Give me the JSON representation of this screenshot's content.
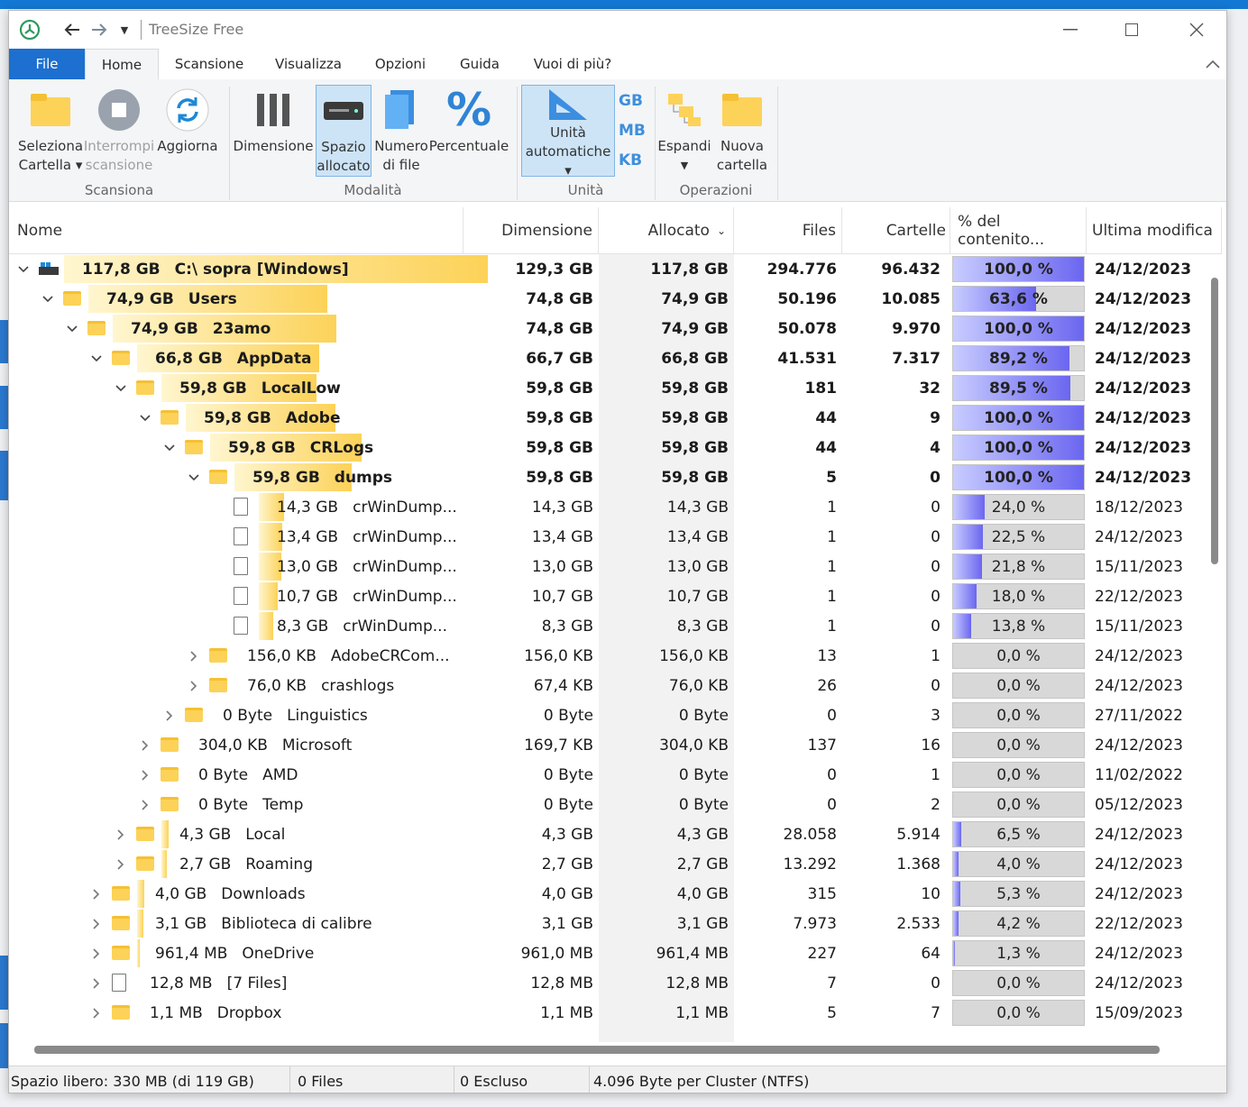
{
  "window": {
    "title": "TreeSize Free"
  },
  "tabs": [
    "File",
    "Home",
    "Scansione",
    "Visualizza",
    "Opzioni",
    "Guida",
    "Vuoi di più?"
  ],
  "ribbon": {
    "select_folder": [
      "Seleziona",
      "Cartella"
    ],
    "stop_scan": [
      "Interrompi",
      "scansione"
    ],
    "refresh": [
      "Aggiorna"
    ],
    "size": [
      "Dimensione"
    ],
    "allocated": [
      "Spazio",
      "allocato"
    ],
    "file_count": [
      "Numero",
      "di file"
    ],
    "percent": [
      "Percentuale"
    ],
    "auto_units": [
      "Unità",
      "automatiche"
    ],
    "units": [
      "GB",
      "MB",
      "KB"
    ],
    "expand": [
      "Espandi"
    ],
    "new_folder": [
      "Nuova",
      "cartella"
    ],
    "groups": [
      "Scansiona",
      "Modalità",
      "Unità",
      "Operazioni"
    ]
  },
  "columns": [
    "Nome",
    "Dimensione",
    "Allocato",
    "Files",
    "Cartelle",
    "% del contenito...",
    "Ultima modifica"
  ],
  "rows": [
    {
      "size_label": "117,8 GB",
      "name": "C:\\  sopra  [Windows]",
      "size": "129,3 GB",
      "alloc": "117,8 GB",
      "files": "294.776",
      "folders": "96.432",
      "pct": "100,0 %",
      "pct_value": 100,
      "date": "24/12/2023"
    },
    {
      "size_label": "74,9 GB",
      "name": "Users",
      "size": "74,8 GB",
      "alloc": "74,9 GB",
      "files": "50.196",
      "folders": "10.085",
      "pct": "63,6 %",
      "pct_value": 63.6,
      "date": "24/12/2023"
    },
    {
      "size_label": "74,9 GB",
      "name": "23amo",
      "size": "74,8 GB",
      "alloc": "74,9 GB",
      "files": "50.078",
      "folders": "9.970",
      "pct": "100,0 %",
      "pct_value": 100,
      "date": "24/12/2023"
    },
    {
      "size_label": "66,8 GB",
      "name": "AppData",
      "size": "66,7 GB",
      "alloc": "66,8 GB",
      "files": "41.531",
      "folders": "7.317",
      "pct": "89,2 %",
      "pct_value": 89.2,
      "date": "24/12/2023"
    },
    {
      "size_label": "59,8 GB",
      "name": "LocalLow",
      "size": "59,8 GB",
      "alloc": "59,8 GB",
      "files": "181",
      "folders": "32",
      "pct": "89,5 %",
      "pct_value": 89.5,
      "date": "24/12/2023"
    },
    {
      "size_label": "59,8 GB",
      "name": "Adobe",
      "size": "59,8 GB",
      "alloc": "59,8 GB",
      "files": "44",
      "folders": "9",
      "pct": "100,0 %",
      "pct_value": 100,
      "date": "24/12/2023"
    },
    {
      "size_label": "59,8 GB",
      "name": "CRLogs",
      "size": "59,8 GB",
      "alloc": "59,8 GB",
      "files": "44",
      "folders": "4",
      "pct": "100,0 %",
      "pct_value": 100,
      "date": "24/12/2023"
    },
    {
      "size_label": "59,8 GB",
      "name": "dumps",
      "size": "59,8 GB",
      "alloc": "59,8 GB",
      "files": "5",
      "folders": "0",
      "pct": "100,0 %",
      "pct_value": 100,
      "date": "24/12/2023"
    },
    {
      "size_label": "14,3 GB",
      "name": "crWinDump...",
      "size": "14,3 GB",
      "alloc": "14,3 GB",
      "files": "1",
      "folders": "0",
      "pct": "24,0 %",
      "pct_value": 24,
      "date": "18/12/2023"
    },
    {
      "size_label": "13,4 GB",
      "name": "crWinDump...",
      "size": "13,4 GB",
      "alloc": "13,4 GB",
      "files": "1",
      "folders": "0",
      "pct": "22,5 %",
      "pct_value": 22.5,
      "date": "24/12/2023"
    },
    {
      "size_label": "13,0 GB",
      "name": "crWinDump...",
      "size": "13,0 GB",
      "alloc": "13,0 GB",
      "files": "1",
      "folders": "0",
      "pct": "21,8 %",
      "pct_value": 21.8,
      "date": "15/11/2023"
    },
    {
      "size_label": "10,7 GB",
      "name": "crWinDump...",
      "size": "10,7 GB",
      "alloc": "10,7 GB",
      "files": "1",
      "folders": "0",
      "pct": "18,0 %",
      "pct_value": 18,
      "date": "22/12/2023"
    },
    {
      "size_label": "8,3 GB",
      "name": "crWinDump...",
      "size": "8,3 GB",
      "alloc": "8,3 GB",
      "files": "1",
      "folders": "0",
      "pct": "13,8 %",
      "pct_value": 13.8,
      "date": "15/11/2023"
    },
    {
      "size_label": "156,0 KB",
      "name": "AdobeCRCom...",
      "size": "156,0 KB",
      "alloc": "156,0 KB",
      "files": "13",
      "folders": "1",
      "pct": "0,0 %",
      "pct_value": 0,
      "date": "24/12/2023"
    },
    {
      "size_label": "76,0 KB",
      "name": "crashlogs",
      "size": "67,4 KB",
      "alloc": "76,0 KB",
      "files": "26",
      "folders": "0",
      "pct": "0,0 %",
      "pct_value": 0,
      "date": "24/12/2023"
    },
    {
      "size_label": "0 Byte",
      "name": "Linguistics",
      "size": "0 Byte",
      "alloc": "0 Byte",
      "files": "0",
      "folders": "3",
      "pct": "0,0 %",
      "pct_value": 0,
      "date": "27/11/2022"
    },
    {
      "size_label": "304,0 KB",
      "name": "Microsoft",
      "size": "169,7 KB",
      "alloc": "304,0 KB",
      "files": "137",
      "folders": "16",
      "pct": "0,0 %",
      "pct_value": 0,
      "date": "24/12/2023"
    },
    {
      "size_label": "0 Byte",
      "name": "AMD",
      "size": "0 Byte",
      "alloc": "0 Byte",
      "files": "0",
      "folders": "1",
      "pct": "0,0 %",
      "pct_value": 0,
      "date": "11/02/2022"
    },
    {
      "size_label": "0 Byte",
      "name": "Temp",
      "size": "0 Byte",
      "alloc": "0 Byte",
      "files": "0",
      "folders": "2",
      "pct": "0,0 %",
      "pct_value": 0,
      "date": "05/12/2023"
    },
    {
      "size_label": "4,3 GB",
      "name": "Local",
      "size": "4,3 GB",
      "alloc": "4,3 GB",
      "files": "28.058",
      "folders": "5.914",
      "pct": "6,5 %",
      "pct_value": 6.5,
      "date": "24/12/2023"
    },
    {
      "size_label": "2,7 GB",
      "name": "Roaming",
      "size": "2,7 GB",
      "alloc": "2,7 GB",
      "files": "13.292",
      "folders": "1.368",
      "pct": "4,0 %",
      "pct_value": 4,
      "date": "24/12/2023"
    },
    {
      "size_label": "4,0 GB",
      "name": "Downloads",
      "size": "4,0 GB",
      "alloc": "4,0 GB",
      "files": "315",
      "folders": "10",
      "pct": "5,3 %",
      "pct_value": 5.3,
      "date": "24/12/2023"
    },
    {
      "size_label": "3,1 GB",
      "name": "Biblioteca di calibre",
      "size": "3,1 GB",
      "alloc": "3,1 GB",
      "files": "7.973",
      "folders": "2.533",
      "pct": "4,2 %",
      "pct_value": 4.2,
      "date": "22/12/2023"
    },
    {
      "size_label": "961,4 MB",
      "name": "OneDrive",
      "size": "961,0 MB",
      "alloc": "961,4 MB",
      "files": "227",
      "folders": "64",
      "pct": "1,3 %",
      "pct_value": 1.3,
      "date": "24/12/2023"
    },
    {
      "size_label": "12,8 MB",
      "name": "[7 Files]",
      "size": "12,8 MB",
      "alloc": "12,8 MB",
      "files": "7",
      "folders": "0",
      "pct": "0,0 %",
      "pct_value": 0,
      "date": "24/12/2023"
    },
    {
      "size_label": "1,1 MB",
      "name": "Dropbox",
      "size": "1,1 MB",
      "alloc": "1,1 MB",
      "files": "5",
      "folders": "7",
      "pct": "0,0 %",
      "pct_value": 0,
      "date": "15/09/2023"
    }
  ],
  "status": {
    "free_space": "Spazio libero: 330 MB  (di 119 GB)",
    "files": "0 Files",
    "excluded": "0 Escluso",
    "cluster": "4.096 Byte per Cluster (NTFS)"
  },
  "colors": {
    "accent": "#1d6fd0",
    "size_bar": "#fcd258",
    "percent_bar": "#6b66f0"
  }
}
